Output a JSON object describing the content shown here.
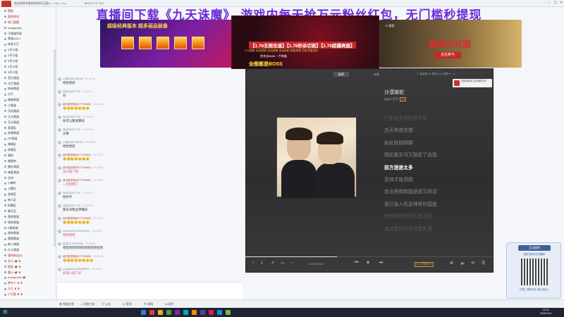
{
  "titlebar": {
    "text": "欢迎来到李紫阳的雨风之屋/U ✓ Ur| ✓ ho...",
    "id": "80717773",
    "count": "179",
    "right": "登录/注册"
  },
  "banner": {
    "title": "直播间下载《九天诛魔》 游戏内每天抢万元粉丝红包，无门槛秒提现"
  },
  "ad_left": {
    "text": "超级经典版本 超多丽品装备"
  },
  "ad_center": {
    "line1": "【1.76无限攻速】【1.76秒杀切割】【1.76超爆爽服】",
    "line2": "1.76倍秒 自动回收 自动拾取 自动挂机 轻松收获 百有币激活码",
    "line3": "首充送6666 一手装备",
    "line4": "全图都是BOSS"
  },
  "ad_right": {
    "brand": "YY语音",
    "title": "魔兽时光服",
    "button": "点击参与"
  },
  "left_panel": {
    "items": [
      {
        "label": "赞助",
        "tag": true
      },
      {
        "label": "我的房间",
        "tag": true
      },
      {
        "label": "热门直播",
        "tag": true
      },
      {
        "label": "orange(nb)",
        "tag": false
      },
      {
        "label": "子频道列表",
        "tag": false
      },
      {
        "label": "频道(43) 1",
        "tag": false
      },
      {
        "label": "休息大厅",
        "tag": false
      },
      {
        "label": "1号小组",
        "tag": false
      },
      {
        "label": "2号小组",
        "tag": false
      },
      {
        "label": "3号小组",
        "tag": false
      },
      {
        "label": "4号小组",
        "tag": false
      },
      {
        "label": "5号小组",
        "tag": false
      },
      {
        "label": "音乐频道",
        "tag": false
      },
      {
        "label": "大厅频道",
        "tag": false
      },
      {
        "label": "休闲频道",
        "tag": false
      },
      {
        "label": "大厅",
        "tag": false
      },
      {
        "label": "情感频道",
        "tag": false
      },
      {
        "label": "小频道",
        "tag": false
      },
      {
        "label": "活动频道",
        "tag": false
      },
      {
        "label": "九天频道",
        "tag": false
      },
      {
        "label": "天天频道",
        "tag": false
      },
      {
        "label": "表演区",
        "tag": false
      },
      {
        "label": "合唱频道",
        "tag": false
      },
      {
        "label": "PK频道",
        "tag": false
      },
      {
        "label": "弹唱区",
        "tag": false
      },
      {
        "label": "听歌区",
        "tag": false
      },
      {
        "label": "我的",
        "tag": false
      },
      {
        "label": "唱歌房",
        "tag": false
      },
      {
        "label": "婚礼频道",
        "tag": false
      },
      {
        "label": "喊麦频道",
        "tag": false
      },
      {
        "label": "主持",
        "tag": false
      },
      {
        "label": "小喇叭",
        "tag": false
      },
      {
        "label": "小舞台",
        "tag": false
      },
      {
        "label": "游戏区",
        "tag": false
      },
      {
        "label": "新人区",
        "tag": false
      },
      {
        "label": "招募区",
        "tag": false
      },
      {
        "label": "聊天区",
        "tag": false
      },
      {
        "label": "其他频道",
        "tag": false
      },
      {
        "label": "相亲频道",
        "tag": false
      },
      {
        "label": "K歌频道",
        "tag": false
      },
      {
        "label": "接待频道",
        "tag": false
      },
      {
        "label": "管理频道",
        "tag": false
      },
      {
        "label": "新人频道",
        "tag": false
      },
      {
        "label": "九九频道",
        "tag": false
      }
    ],
    "users": [
      {
        "label": "我的粉丝(5)"
      },
      {
        "label": "灵儿 🦋 ♛"
      },
      {
        "label": "星辰 🦋 ♛"
      },
      {
        "label": "暖心 🦋 ♛"
      },
      {
        "label": "orange(nb) 🦋"
      },
      {
        "label": "梦中人 ♛ ♛"
      },
      {
        "label": "九九 ♛ ♛"
      },
      {
        "label": "小可爱 ♛ ♛"
      }
    ]
  },
  "chat": {
    "messages": [
      {
        "name": "大家好(98788740)",
        "time": "21:18:15",
        "text": "哈哈哈哈",
        "vip": false,
        "pink": false
      },
      {
        "name": "咕咕鸟(567714)",
        "time": "21:18:11",
        "text": "对",
        "vip": false,
        "pink": false
      },
      {
        "name": "我可爱宠物(5677754652)",
        "time": "21:18:13",
        "text": "😊😊😊😊😊😊😊",
        "vip": true,
        "pink": true
      },
      {
        "name": "咕咕鸟(567714)",
        "time": "21:18:18",
        "text": "你可以算查算啥",
        "vip": false,
        "pink": false
      },
      {
        "name": "咕咕鸟(567714)",
        "time": "21:18:16",
        "text": "没事",
        "vip": false,
        "pink": false
      },
      {
        "name": "大家好(98788740)",
        "time": "21:18:26",
        "text": "哈哈哈哈",
        "vip": false,
        "pink": false
      },
      {
        "name": "我可爱宠物(5677754652)",
        "time": "21:19:07",
        "text": "😊😊😊😊😊😊😊",
        "vip": true,
        "pink": true
      },
      {
        "name": "我可爱宠物(5677754652)",
        "time": "21:19:08",
        "text": "怎么搞了呢",
        "vip": true,
        "pink": true
      },
      {
        "name": "我可爱宠物(5677754652)",
        "time": "21:19:09",
        "text": "一句话哦了",
        "vip": true,
        "pink": true
      },
      {
        "name": "咕咕鸟(567714)",
        "time": "21:19:24",
        "text": "你好坏",
        "vip": false,
        "pink": false
      },
      {
        "name": "咕咕鸟(567714)",
        "time": "21:19:26",
        "text": "我去叫我出神嘴的",
        "vip": false,
        "pink": false
      },
      {
        "name": "我可爱宠物(5677754652)",
        "time": "21:19:29",
        "text": "😊😊😊😊😊😊😊",
        "vip": true,
        "pink": true
      },
      {
        "name": "orange(nb)(789466299)",
        "time": "21:20:05",
        "text": "哈哈哈哈",
        "vip": false,
        "pink": true
      },
      {
        "name": "哈哈(3711527848)",
        "time": "21:20:05",
        "text": "哈哈哈哈哈哈哈哈哈哈哈哈哈",
        "vip": false,
        "pink": false
      },
      {
        "name": "我可爱宠物(5677754652)",
        "time": "21:20:44",
        "text": "😊😊😊😊😊😊😊😊",
        "vip": true,
        "pink": true
      },
      {
        "name": "orange(nb)(789466299)",
        "time": "21:20:45",
        "text": "知道人家了好",
        "vip": false,
        "pink": true
      }
    ]
  },
  "player": {
    "tabs": [
      {
        "label": "推荐",
        "active": true
      },
      {
        "label": "动态",
        "active": false
      }
    ],
    "top_controls": "⊙ 高品质 ▾   ≡ 歌词 ▾   ⊡ 全屏 ▾   ─  ✕",
    "song_title": "沙漠骆驼",
    "song_artist": "展展与罗罗",
    "quality_badge": "VIP",
    "lyrics": [
      {
        "text": "行走在无尽的苍茫茫",
        "state": "fade"
      },
      {
        "text": "白天黑夜交错",
        "state": "past"
      },
      {
        "text": "如此妖娆啊娜",
        "state": "past"
      },
      {
        "text": "蹉跎着岁月又蹉跎了自我",
        "state": "past"
      },
      {
        "text": "前方迷途太多",
        "state": "current"
      },
      {
        "text": "坚持才能洒脱",
        "state": "next"
      },
      {
        "text": "走出黑暗就能逍遥又快活",
        "state": "next"
      },
      {
        "text": "我已染入在这神奇的国度",
        "state": "next"
      },
      {
        "text": "轮转相伴走向圣堂之路",
        "state": "fade"
      },
      {
        "text": "谁说我的世界疏离失落",
        "state": "fade"
      }
    ],
    "elapsed": "02:04",
    "duration": "05:38",
    "progress": 0.37,
    "quality": "SQ 无损音质 ▾",
    "login_chip": "您尚未登录 正在播放试听"
  },
  "qr_card": {
    "head": "互动福利",
    "sub": "微信扫码关注领福利",
    "foot": "扫描二维码关注\n或点击加入"
  },
  "bottombar": {
    "items": [
      "✚ 频道信息",
      "♫ 开播工具",
      "◎ 公告",
      "☑ 签到",
      "▣ 表情",
      "AI 助手"
    ]
  },
  "taskbar": {
    "time": "21:20",
    "date": "2025/1/24"
  }
}
